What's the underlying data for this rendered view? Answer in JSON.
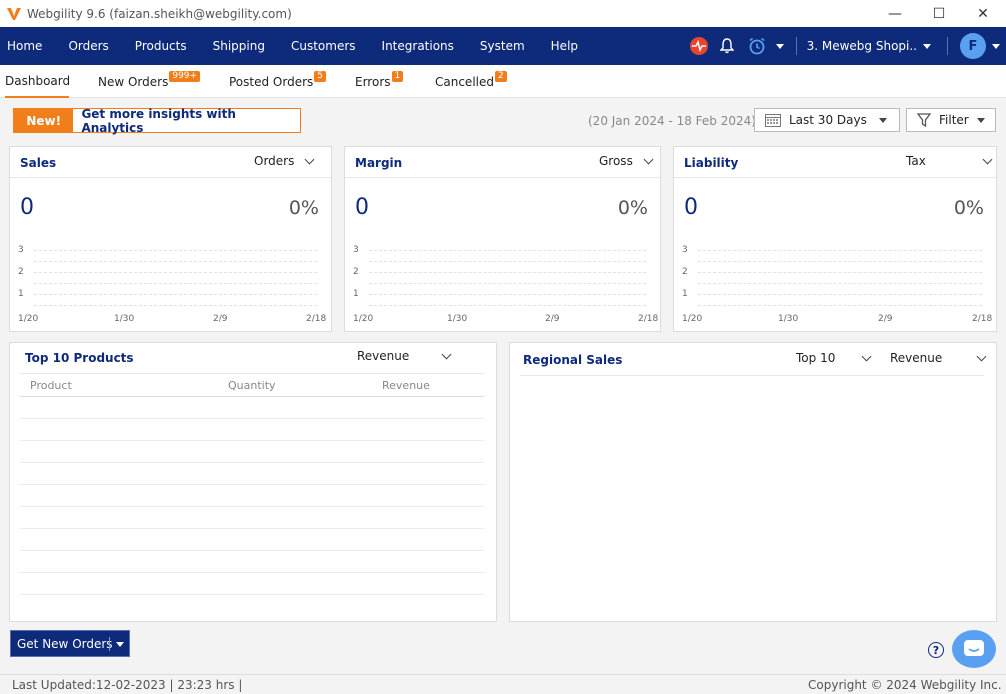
{
  "window": {
    "title": "Webgility 9.6 (faizan.sheikh@webgility.com)",
    "controls": {
      "minimize": "—",
      "maximize": "☐",
      "close": "✕"
    }
  },
  "nav": {
    "items": [
      "Home",
      "Orders",
      "Products",
      "Shipping",
      "Customers",
      "Integrations",
      "System",
      "Help"
    ],
    "store": "3. Mewebg Shopi..",
    "avatar": "F"
  },
  "subtabs": [
    {
      "label": "Dashboard",
      "badge": ""
    },
    {
      "label": "New Orders",
      "badge": "999+"
    },
    {
      "label": "Posted Orders",
      "badge": "5"
    },
    {
      "label": "Errors",
      "badge": "1"
    },
    {
      "label": "Cancelled",
      "badge": "2"
    }
  ],
  "promo": {
    "new": "New!",
    "text": "Get more insights with Analytics"
  },
  "toolbar": {
    "daterange": "(20 Jan 2024 - 18 Feb 2024)",
    "period": "Last 30 Days",
    "filter": "Filter"
  },
  "cards": [
    {
      "title": "Sales",
      "select": "Orders",
      "value": "0",
      "pct": "0%"
    },
    {
      "title": "Margin",
      "select": "Gross",
      "value": "0",
      "pct": "0%"
    },
    {
      "title": "Liability",
      "select": "Tax",
      "value": "0",
      "pct": "0%"
    }
  ],
  "chart": {
    "yticks": [
      "3",
      "2",
      "1"
    ],
    "xticks": [
      "1/20",
      "1/30",
      "2/9",
      "2/18"
    ]
  },
  "top_products": {
    "title": "Top 10 Products",
    "select": "Revenue",
    "headers": [
      "Product",
      "Quantity",
      "Revenue"
    ]
  },
  "regional": {
    "title": "Regional Sales",
    "select1": "Top 10",
    "select2": "Revenue"
  },
  "actions": {
    "get_orders": "Get New Orders"
  },
  "footer": {
    "last_updated": "Last Updated:12-02-2023 | 23:23 hrs |",
    "copyright": "Copyright © 2024 Webgility Inc. ..:"
  },
  "colors": {
    "nav": "#0e2a7a",
    "accent": "#f07e1b"
  }
}
